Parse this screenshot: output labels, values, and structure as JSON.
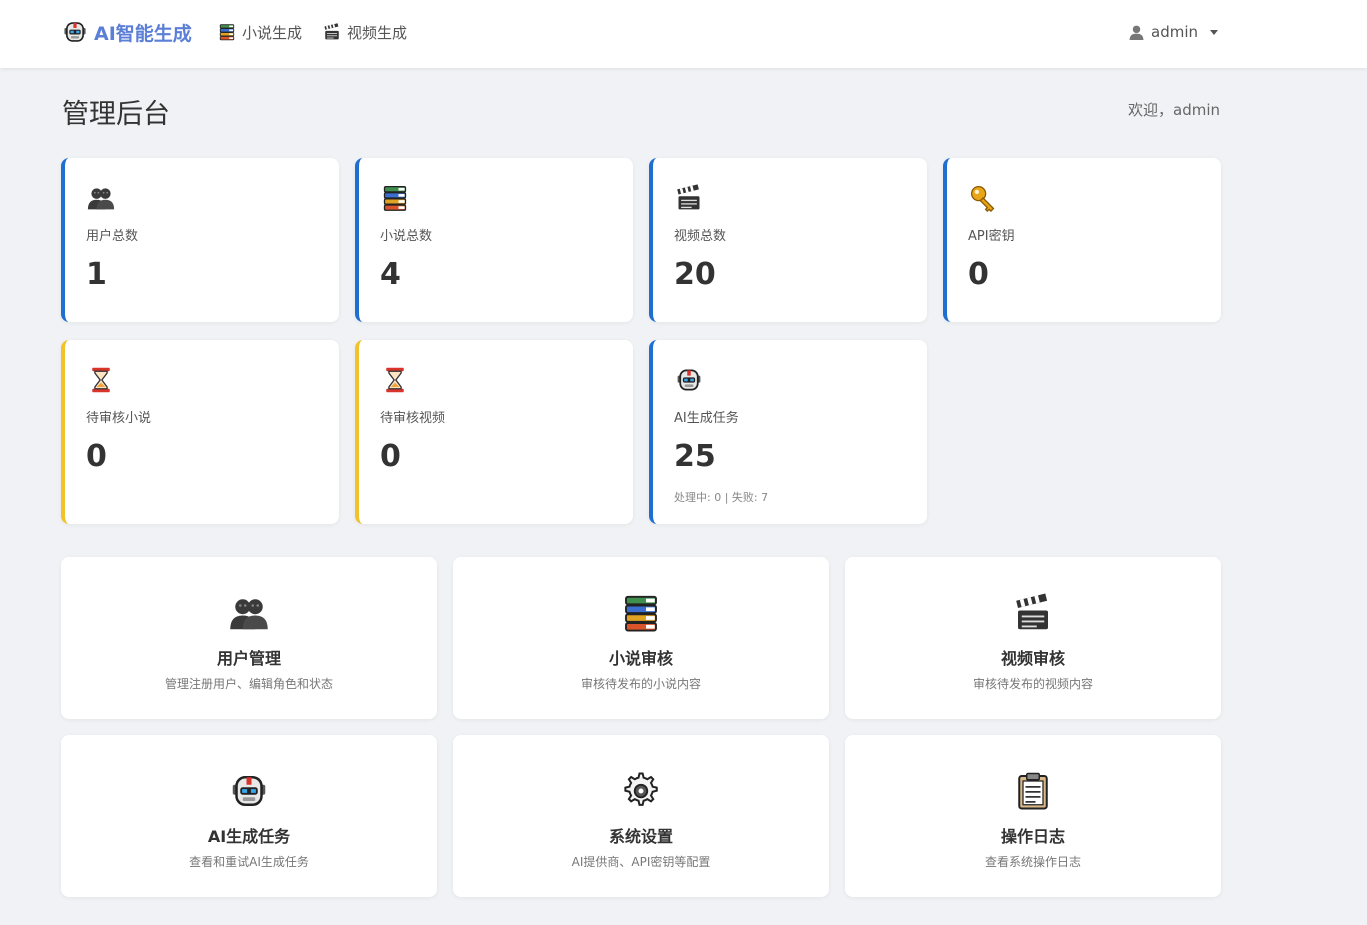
{
  "navbar": {
    "brand": "AI智能生成",
    "links": [
      {
        "label": "小说生成",
        "icon": "books-icon"
      },
      {
        "label": "视频生成",
        "icon": "clapper-icon"
      }
    ],
    "user": "admin"
  },
  "page": {
    "title": "管理后台",
    "welcome": "欢迎，admin"
  },
  "stats": [
    {
      "label": "用户总数",
      "value": "1",
      "icon": "users-icon",
      "accent": "#1f6fd1"
    },
    {
      "label": "小说总数",
      "value": "4",
      "icon": "books-icon",
      "accent": "#1f6fd1"
    },
    {
      "label": "视频总数",
      "value": "20",
      "icon": "clapper-icon",
      "accent": "#1f6fd1"
    },
    {
      "label": "API密钥",
      "value": "0",
      "icon": "key-icon",
      "accent": "#1f6fd1"
    },
    {
      "label": "待审核小说",
      "value": "0",
      "icon": "hourglass-icon",
      "accent": "#f2c229"
    },
    {
      "label": "待审核视频",
      "value": "0",
      "icon": "hourglass-icon",
      "accent": "#f2c229"
    },
    {
      "label": "AI生成任务",
      "value": "25",
      "sub": "处理中: 0 | 失败: 7",
      "icon": "robot-icon",
      "accent": "#1f6fd1"
    }
  ],
  "actions": [
    {
      "title": "用户管理",
      "desc": "管理注册用户、编辑角色和状态",
      "icon": "users-icon"
    },
    {
      "title": "小说审核",
      "desc": "审核待发布的小说内容",
      "icon": "books-icon"
    },
    {
      "title": "视频审核",
      "desc": "审核待发布的视频内容",
      "icon": "clapper-icon"
    },
    {
      "title": "AI生成任务",
      "desc": "查看和重试AI生成任务",
      "icon": "robot-icon"
    },
    {
      "title": "系统设置",
      "desc": "AI提供商、API密钥等配置",
      "icon": "gear-icon"
    },
    {
      "title": "操作日志",
      "desc": "查看系统操作日志",
      "icon": "clipboard-icon"
    }
  ]
}
